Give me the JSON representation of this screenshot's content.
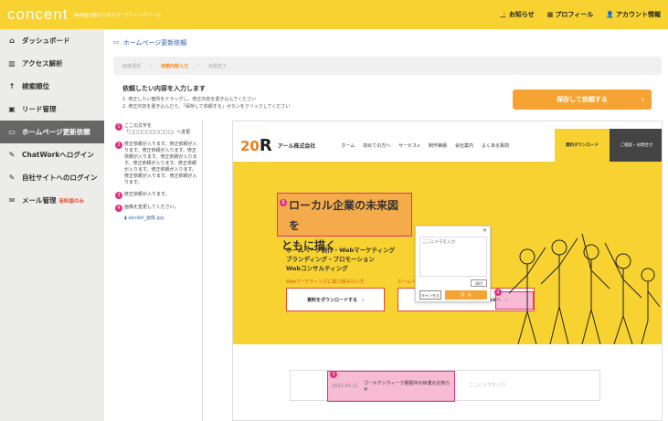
{
  "topbar": {
    "logo": "concent",
    "tagline": "Web担当者のためのマーケティングツール",
    "nav": [
      {
        "icon": "bell-icon",
        "glyph": "🔔",
        "label": "お知らせ"
      },
      {
        "icon": "building-icon",
        "glyph": "▦",
        "label": "プロフィール"
      },
      {
        "icon": "user-icon",
        "glyph": "👤",
        "label": "アカウント情報"
      }
    ]
  },
  "sidebar": {
    "items": [
      {
        "icon": "home-icon",
        "glyph": "⌂",
        "label": "ダッシュボード"
      },
      {
        "icon": "chart-icon",
        "glyph": "▥",
        "label": "アクセス解析"
      },
      {
        "icon": "arrow-up-icon",
        "glyph": "↑",
        "label": "検索順位"
      },
      {
        "icon": "lead-icon",
        "glyph": "▣",
        "label": "リード管理"
      },
      {
        "icon": "monitor-icon",
        "glyph": "▭",
        "label": "ホームページ更新依頼"
      },
      {
        "icon": "edit-icon",
        "glyph": "✎",
        "label": "ChatWorkへログイン"
      },
      {
        "icon": "edit-icon",
        "glyph": "✎",
        "label": "自社サイトへのログイン"
      },
      {
        "icon": "mail-icon",
        "glyph": "✉",
        "label": "メール管理",
        "badge": "有料版のみ"
      }
    ]
  },
  "main": {
    "title": "ホームページ更新依頼",
    "steps": [
      "画像選択",
      "依頼内容入力",
      "依頼完了"
    ],
    "instructions": {
      "heading": "依頼したい内容を入力します",
      "line1": "1. 修正したい箇所をドラッグし、修正内容を書き込んでください",
      "line2": "2. 修正内容を書き込んだら、「保存して依頼する」ボタンをクリックしてください"
    },
    "save_button": "保存して依頼する",
    "notes": [
      {
        "num": "1",
        "text": "ここの文字を「□□□□□□□□□□」へ変更"
      },
      {
        "num": "2",
        "text": "修正依頼が入ります。修正依頼が入ります。修正依頼が入ります。修正依頼が入ります。修正依頼が入ります。修正依頼が入ります。修正依頼が入ります。修正依頼が入ります。修正依頼が入ります。修正依頼が入ります。"
      },
      {
        "num": "3",
        "text": "修正依頼が入ります。"
      },
      {
        "num": "4",
        "text": "画像を変更してください。",
        "file": "abcdef_画像.jpg"
      }
    ]
  },
  "preview": {
    "logo_num": "20",
    "logo_r": "R",
    "company": "アール株式会社",
    "nav": [
      "ホーム",
      "初めての方へ",
      "サービス∨",
      "制作実績",
      "会社案内",
      "よくある質問"
    ],
    "download": "資料ダウンロード",
    "contact": "ご相談・お問合せ",
    "headline1": "ローカル企業の未来図を",
    "headline2": "ともに描く",
    "sub1": "ホームページ制作・Webマーケティング",
    "sub2": "ブランディング・プロモーション",
    "sub3": "Webコンサルティング",
    "small1": "Webマーケティングに取り組みたい方",
    "small2": "ホームページ制作をお考えの方",
    "cta1": "資料をダウンロードする　›",
    "cta2": "ホームページ基礎価格プラン Pickへ　›",
    "popup": {
      "placeholder": "ここにメモを入力",
      "attach": "添付",
      "cancel": "キャンセル",
      "ok": "保　存"
    },
    "news_date": "2022.04.21",
    "news_title": "ゴールデンウィーク期間中の休業のお知らせ",
    "news_placeholder": "ここにメモを入力"
  }
}
